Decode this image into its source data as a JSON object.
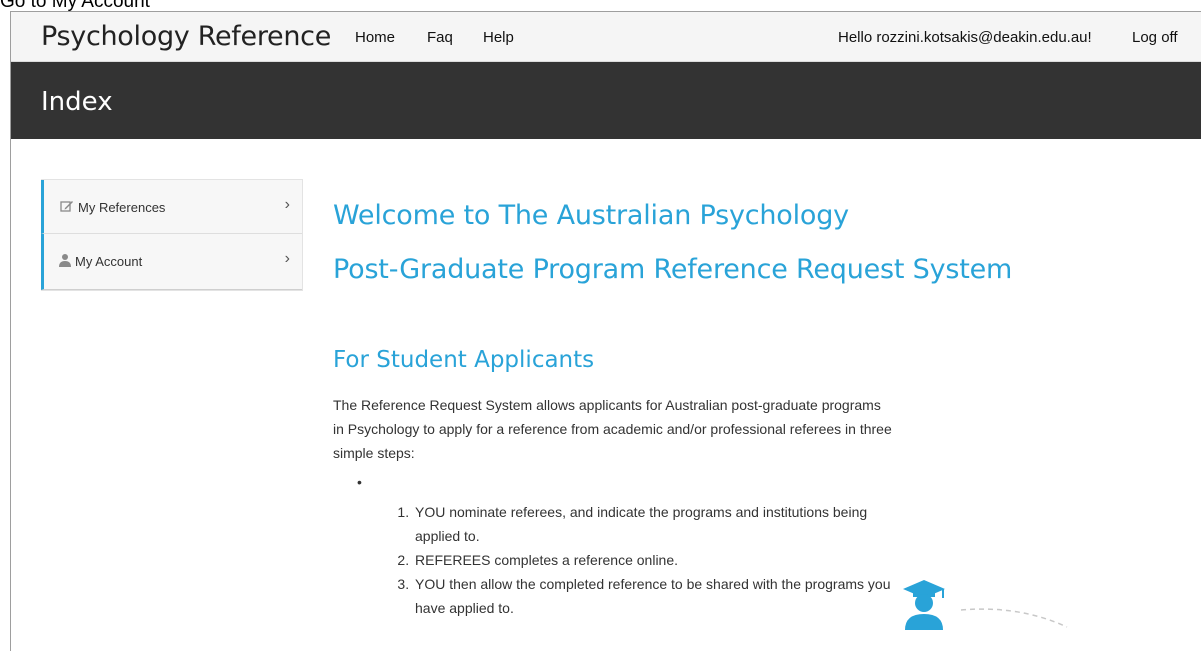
{
  "caption": "Go to My Account",
  "navbar": {
    "brand": "Psychology Reference",
    "links": [
      "Home",
      "Faq",
      "Help"
    ],
    "greeting": "Hello rozzini.kotsakis@deakin.edu.au!",
    "logoff": "Log off"
  },
  "page": {
    "title": "Index"
  },
  "sidebar": {
    "items": [
      {
        "label": "My References",
        "icon": "edit-icon"
      },
      {
        "label": "My Account",
        "icon": "user-icon"
      }
    ]
  },
  "main": {
    "welcome_line1": "Welcome to The Australian Psychology",
    "welcome_line2": "Post-Graduate Program Reference Request System",
    "section_title": "For Student Applicants",
    "intro": "The Reference Request System allows applicants for Australian post-graduate programs in Psychology to apply for a reference from academic and/or professional referees in three simple steps:",
    "bullet": "•",
    "steps": [
      "YOU nominate referees, and indicate the programs and institutions being applied to.",
      "REFEREES completes a reference online.",
      "YOU then allow the completed reference to be shared with the programs you have applied to."
    ]
  },
  "colors": {
    "accent": "#29a3d8",
    "titlebar": "#333333"
  }
}
